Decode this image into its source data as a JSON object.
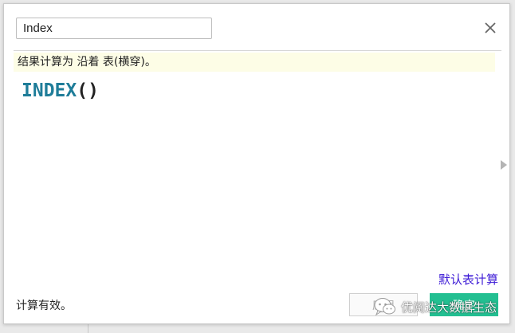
{
  "calc_dialog": {
    "name_value": "Index",
    "info_text": "结果计算为 沿着 表(横穿)。",
    "formula": {
      "function_name": "INDEX",
      "parens": "()"
    },
    "default_table_calc_link": "默认表计算",
    "status_text": "计算有效。",
    "apply_button": "应用",
    "ok_button": "确定",
    "icons": {
      "close": "close-icon",
      "scroll_right": "triangle-right-icon"
    },
    "colors": {
      "function": "#1f7d99",
      "info_bar_bg": "#fdfde6",
      "link": "#3d1bd6",
      "ok_button_bg": "#23bf91"
    }
  },
  "watermark": {
    "icon": "wechat-icon",
    "text": "优阅达大数据生态"
  }
}
